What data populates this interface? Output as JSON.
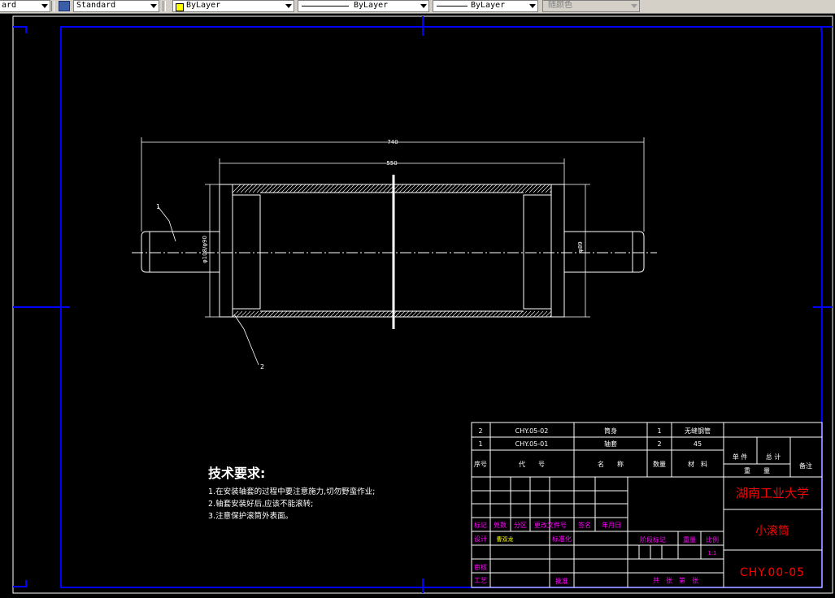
{
  "toolbar": {
    "textstyle_partial": "ard",
    "dimstyle": "Standard",
    "layer_color": "ByLayer",
    "linetype": "ByLayer",
    "lineweight": "ByLayer",
    "plotstyle": "随颜色"
  },
  "colors": {
    "background": "#000000",
    "frame": "#0000ff",
    "lines": "#ffffff",
    "titleblock_label": "#ff00ff",
    "org_text": "#ff0000",
    "bylayer_swatch": "#ffff00"
  },
  "drawing": {
    "dims": {
      "overall": "740",
      "body": "550",
      "bore": "φ89",
      "outer": "φ108/φ90"
    },
    "balloons": [
      "1",
      "2"
    ]
  },
  "tech": {
    "title": "技术要求:",
    "items": [
      "1.在安装轴套的过程中要注意施力,切勿野蛮作业;",
      "2.轴套安装好后,应该不能滚转;",
      "3.注意保护滚筒外表面。"
    ]
  },
  "bom": {
    "rows": [
      {
        "no": "2",
        "code": "CHY.05-02",
        "name": "筒身",
        "qty": "1",
        "material": "无缝钢管"
      },
      {
        "no": "1",
        "code": "CHY.05-01",
        "name": "轴套",
        "qty": "2",
        "material": "45"
      }
    ],
    "header": {
      "no": "序号",
      "code": "代　　号",
      "name": "名　　称",
      "qty": "数量",
      "material": "材　料",
      "single": "单 件",
      "total": "总 计",
      "weight": "重　　量",
      "remark": "备注"
    }
  },
  "titleblock": {
    "mark": "标记",
    "count": "处数",
    "zone": "分区",
    "docno": "更改文件号",
    "sign": "签名",
    "date": "年月日",
    "design": "设计",
    "designer": "曹双龙",
    "standardize": "标准化",
    "stage": "阶段标记",
    "weight": "重量",
    "scale_label": "比例",
    "scale": "1:1",
    "review": "审核",
    "process": "工艺",
    "approve": "批准",
    "sheets": "共　张　第　张",
    "org": "湖南工业大学",
    "drawing_name": "小滚筒",
    "drawing_no": "CHY.00-05"
  }
}
